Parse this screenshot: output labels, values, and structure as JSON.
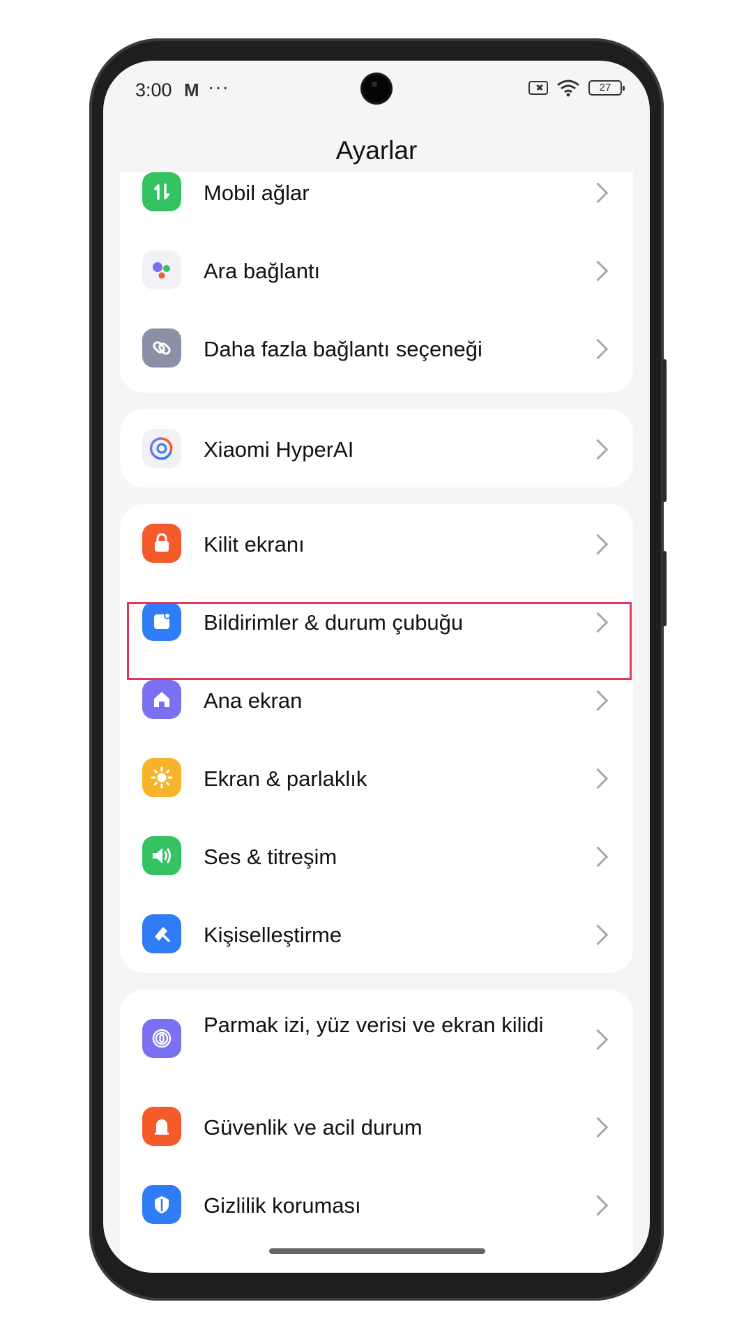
{
  "status": {
    "time": "3:00",
    "mail_glyph": "M",
    "more": "···",
    "battery": "27"
  },
  "header": {
    "title": "Ayarlar"
  },
  "groups": [
    {
      "items": [
        {
          "label": "Mobil ağlar",
          "icon": "mobile-data-icon",
          "color": "#35c262"
        },
        {
          "label": "Ara bağlantı",
          "icon": "interconnect-icon",
          "color": "#f2f2f6"
        },
        {
          "label": "Daha fazla bağlantı seçeneği",
          "icon": "link-icon",
          "color": "#8a90a8"
        }
      ]
    },
    {
      "items": [
        {
          "label": "Xiaomi HyperAI",
          "icon": "hyperai-icon",
          "color": "#f2f2f6"
        }
      ]
    },
    {
      "items": [
        {
          "label": "Kilit ekranı",
          "icon": "lock-icon",
          "color": "#f45a2a"
        },
        {
          "label": "Bildirimler & durum çubuğu",
          "icon": "notification-icon",
          "color": "#2f7cf6"
        },
        {
          "label": "Ana ekran",
          "icon": "home-icon",
          "color": "#7a70f2"
        },
        {
          "label": "Ekran & parlaklık",
          "icon": "sun-icon",
          "color": "#f7b42a"
        },
        {
          "label": "Ses & titreşim",
          "icon": "speaker-icon",
          "color": "#35c262"
        },
        {
          "label": "Kişiselleştirme",
          "icon": "brush-icon",
          "color": "#2f7cf6"
        }
      ]
    },
    {
      "items": [
        {
          "label": "Parmak izi, yüz verisi ve ekran kilidi",
          "icon": "fingerprint-icon",
          "color": "#7a70f2"
        },
        {
          "label": "Güvenlik ve acil durum",
          "icon": "emergency-icon",
          "color": "#f45a2a"
        },
        {
          "label": "Gizlilik koruması",
          "icon": "privacy-icon",
          "color": "#2f7cf6"
        }
      ]
    }
  ]
}
